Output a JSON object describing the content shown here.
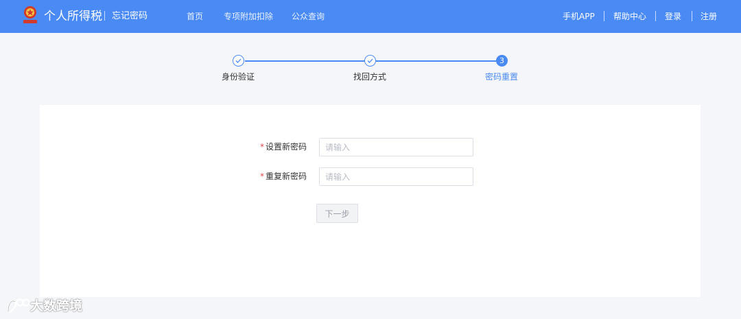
{
  "header": {
    "app_title": "个人所得税",
    "page_subtitle": "忘记密码",
    "emblem_icon": "national-emblem-icon",
    "brand_color": "#4a8af4",
    "nav": [
      {
        "label": "首页"
      },
      {
        "label": "专项附加扣除"
      },
      {
        "label": "公众查询"
      }
    ],
    "right_links": [
      {
        "label": "手机APP"
      },
      {
        "label": "帮助中心"
      },
      {
        "label": "登录"
      },
      {
        "label": "注册"
      }
    ]
  },
  "steps": [
    {
      "label": "身份验证",
      "status": "done",
      "icon": "check-icon"
    },
    {
      "label": "找回方式",
      "status": "done",
      "icon": "check-icon"
    },
    {
      "label": "密码重置",
      "status": "current",
      "number": "3"
    }
  ],
  "form": {
    "new_password": {
      "required_mark": "*",
      "label": "设置新密码",
      "placeholder": "请输入",
      "value": ""
    },
    "repeat_password": {
      "required_mark": "*",
      "label": "重复新密码",
      "placeholder": "请输入",
      "value": ""
    },
    "next_label": "下一步",
    "next_disabled": true
  },
  "watermark": {
    "text": "大数跨境",
    "icon": "watermark-logo-icon"
  }
}
